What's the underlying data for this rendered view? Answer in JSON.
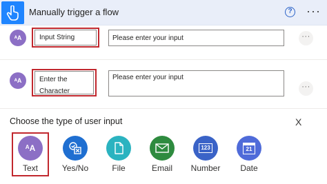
{
  "header": {
    "title": "Manually trigger a flow",
    "help_icon": "question-circle-icon",
    "help_glyph": "?",
    "more_glyph": "···",
    "accent": "#1f85ff"
  },
  "inputs": [
    {
      "avatar_text": "ᴬA",
      "name_line1": "Input String",
      "name_line2": "",
      "placeholder": "Please enter your input",
      "more_glyph": "···"
    },
    {
      "avatar_text": "ᴬA",
      "name_line1": "Enter the",
      "name_line2": "Character",
      "placeholder": "Please enter your input",
      "more_glyph": "···"
    }
  ],
  "chooser": {
    "title": "Choose the type of user input",
    "close_glyph": "X",
    "types": [
      {
        "label": "Text",
        "icon": "text-aa-icon",
        "color": "#8c6fc5",
        "glyph": "ᴬA"
      },
      {
        "label": "Yes/No",
        "icon": "yes-no-icon",
        "color": "#1f6fd1"
      },
      {
        "label": "File",
        "icon": "file-icon",
        "color": "#2bb3c0"
      },
      {
        "label": "Email",
        "icon": "email-icon",
        "color": "#2e8b3f"
      },
      {
        "label": "Number",
        "icon": "number-icon",
        "color": "#3a63c7",
        "glyph": "123"
      },
      {
        "label": "Date",
        "icon": "calendar-icon",
        "color": "#4f6bd9",
        "glyph": "21"
      }
    ]
  },
  "highlight_color": "#c1272d"
}
